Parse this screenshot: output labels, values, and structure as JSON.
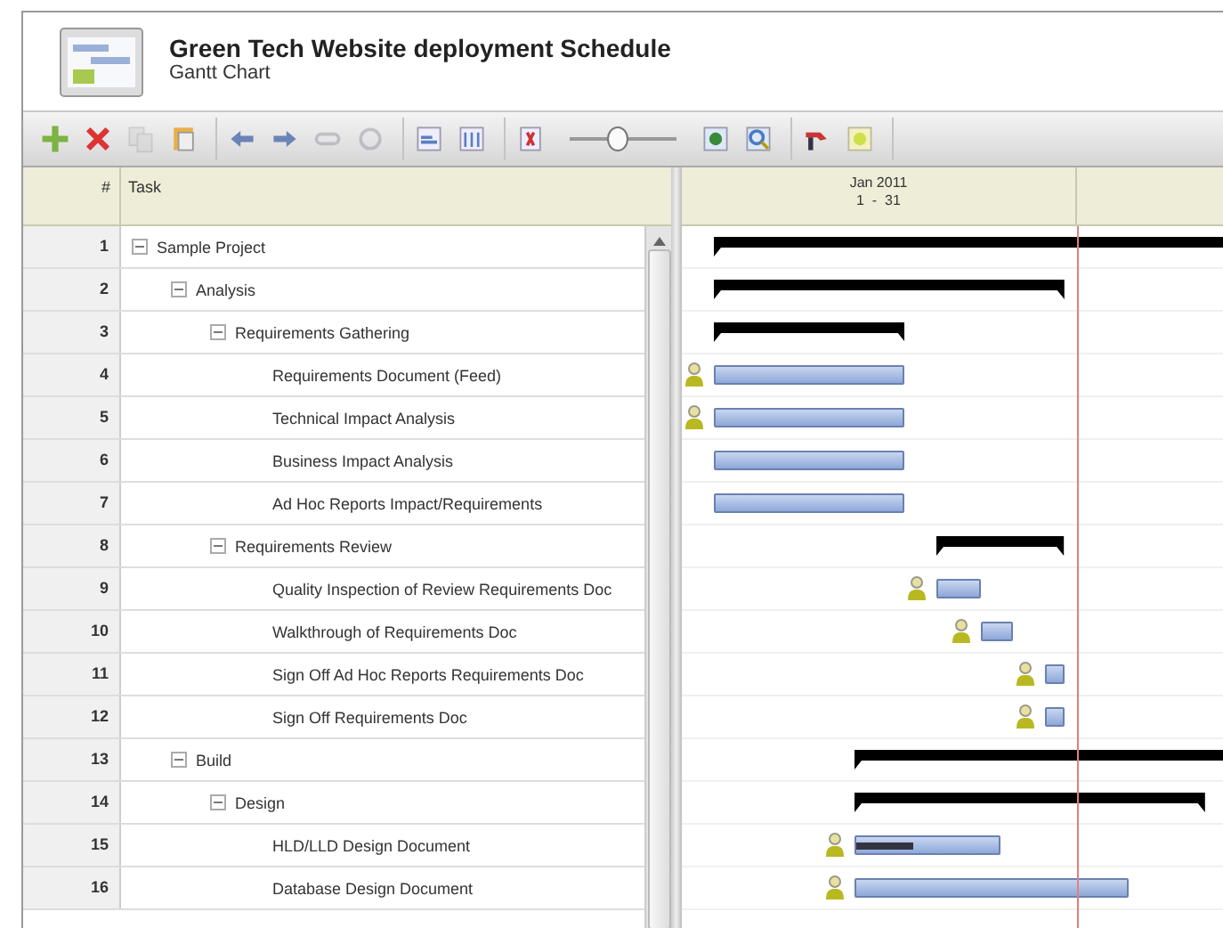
{
  "header": {
    "title": "Green Tech Website deployment Schedule",
    "subtitle": "Gantt Chart"
  },
  "toolbar": {
    "groups": [
      [
        {
          "kind": "add",
          "disabled": false
        },
        {
          "kind": "delete",
          "disabled": false
        },
        {
          "kind": "copy",
          "disabled": true
        },
        {
          "kind": "paste",
          "disabled": false
        }
      ],
      [
        {
          "kind": "outdent",
          "disabled": false
        },
        {
          "kind": "indent",
          "disabled": false
        },
        {
          "kind": "link",
          "disabled": true
        },
        {
          "kind": "unlink",
          "disabled": true
        }
      ],
      [
        {
          "kind": "page",
          "disabled": false
        },
        {
          "kind": "pages",
          "disabled": false
        }
      ],
      [
        {
          "kind": "fit",
          "disabled": false
        },
        {
          "kind": "slider",
          "level": 0.45
        },
        {
          "kind": "zoom-in",
          "disabled": false
        },
        {
          "kind": "zoom-out",
          "disabled": false
        }
      ],
      [
        {
          "kind": "tool",
          "disabled": false
        },
        {
          "kind": "clock",
          "disabled": false
        }
      ]
    ]
  },
  "columns": {
    "number": "#",
    "task": "Task"
  },
  "timescale": {
    "month": "Jan 2011",
    "days": "1  -  31"
  },
  "tasks": [
    {
      "num": "1",
      "name": "Sample Project",
      "kind": "summary",
      "expanded": true,
      "children": [
        {
          "num": "2",
          "name": "Analysis",
          "kind": "summary",
          "expanded": true,
          "children": [
            {
              "num": "3",
              "name": "Requirements Gathering",
              "kind": "summary",
              "expanded": true,
              "children": [
                {
                  "num": "4",
                  "name": "Requirements Document (Feed)",
                  "kind": "task",
                  "assigned": true
                },
                {
                  "num": "5",
                  "name": "Technical Impact Analysis",
                  "kind": "task",
                  "assigned": true
                },
                {
                  "num": "6",
                  "name": "Business Impact Analysis",
                  "kind": "task",
                  "assigned": false
                },
                {
                  "num": "7",
                  "name": "Ad Hoc Reports Impact/Requirements",
                  "kind": "task",
                  "assigned": false
                }
              ]
            },
            {
              "num": "8",
              "name": "Requirements Review",
              "kind": "summary",
              "expanded": true,
              "children": [
                {
                  "num": "9",
                  "name": "Quality Inspection of Review Requirements Doc",
                  "kind": "task",
                  "assigned": true
                },
                {
                  "num": "10",
                  "name": "Walkthrough of Requirements Doc",
                  "kind": "task",
                  "assigned": true
                },
                {
                  "num": "11",
                  "name": "Sign Off Ad Hoc Reports Requirements Doc",
                  "kind": "task",
                  "assigned": true
                },
                {
                  "num": "12",
                  "name": "Sign Off Requirements Doc",
                  "kind": "task",
                  "assigned": true
                }
              ]
            }
          ]
        },
        {
          "num": "13",
          "name": "Build",
          "kind": "summary",
          "expanded": true,
          "children": [
            {
              "num": "14",
              "name": "Design",
              "kind": "summary",
              "expanded": true,
              "children": [
                {
                  "num": "15",
                  "name": "HLD/LLD Design Document",
                  "kind": "task",
                  "assigned": true,
                  "level": 0.4
                },
                {
                  "num": "16",
                  "name": "Database Design Document",
                  "kind": "task",
                  "assigned": true
                }
              ]
            }
          ]
        }
      ]
    }
  ]
}
